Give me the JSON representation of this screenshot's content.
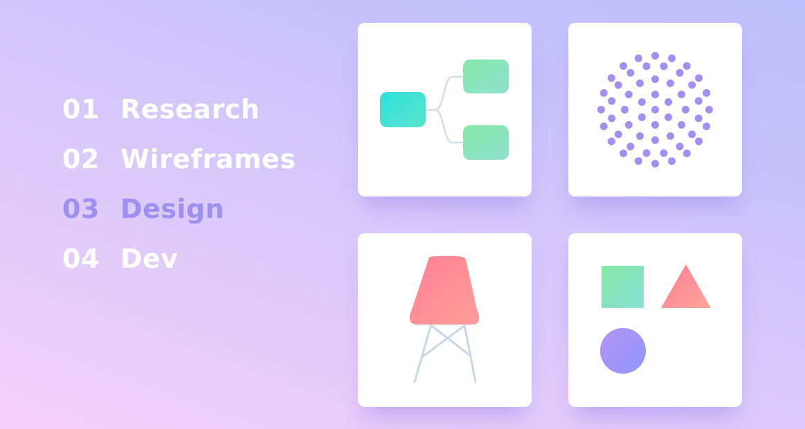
{
  "steps": [
    {
      "num": "01",
      "label": "Research",
      "active": false
    },
    {
      "num": "02",
      "label": "Wireframes",
      "active": false
    },
    {
      "num": "03",
      "label": "Design",
      "active": true
    },
    {
      "num": "04",
      "label": "Dev",
      "active": false
    }
  ],
  "colors": {
    "text_default": "#ffffff",
    "text_active": "#9d90f0",
    "teal": "#2ee0d6",
    "mint": "#8ce8b0",
    "dot_purple": "#a48ef2",
    "coral": "#ff8f9c",
    "lavender": "#9d90f8"
  },
  "cards": [
    {
      "name": "flowchart-card",
      "icon": "flowchart-icon"
    },
    {
      "name": "dot-sphere-card",
      "icon": "dot-sphere-icon"
    },
    {
      "name": "chair-card",
      "icon": "chair-icon"
    },
    {
      "name": "shapes-card",
      "icon": "shapes-icon"
    }
  ]
}
